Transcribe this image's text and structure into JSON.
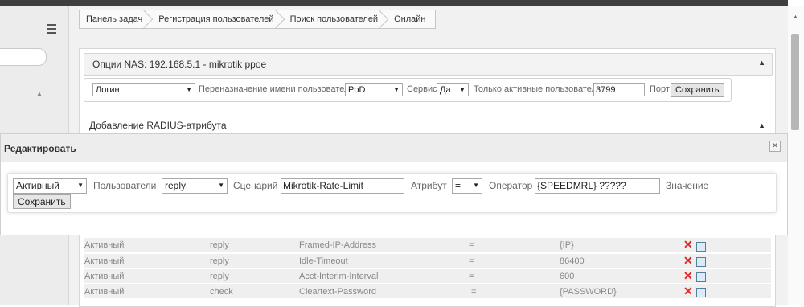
{
  "breadcrumb": [
    "Панель задач",
    "Регистрация пользователей",
    "Поиск пользователей",
    "Онлайн"
  ],
  "nas": {
    "title": "Опции NAS: 192.168.5.1 - mikrotik ppoe"
  },
  "filter": {
    "select_value": "Логин",
    "reassign_label": "Переназначение имени пользователя",
    "pod_value": "PoD",
    "service_label": "Сервис",
    "yes_value": "Да",
    "only_active_label": "Только активные пользователи",
    "active_input": "3799",
    "port_label": "Порт",
    "save_label": "Сохранить"
  },
  "radius": {
    "title": "Добавление RADIUS-атрибута"
  },
  "dialog": {
    "title": "Редактировать",
    "status_value": "Активный",
    "users_label": "Пользователи",
    "users_value": "reply",
    "scenario_label": "Сценарий",
    "scenario_value": "Mikrotik-Rate-Limit",
    "attribute_label": "Атрибут",
    "attribute_value": "=",
    "operator_label": "Оператор",
    "operator_value": "{SPEEDMRL} ?????",
    "value_label": "Значение",
    "save_label": "Сохранить"
  },
  "table": [
    {
      "status": "Активный",
      "type": "reply",
      "attr": "Framed-IP-Address",
      "op": "=",
      "value": "{IP}"
    },
    {
      "status": "Активный",
      "type": "reply",
      "attr": "Idle-Timeout",
      "op": "=",
      "value": "86400"
    },
    {
      "status": "Активный",
      "type": "reply",
      "attr": "Acct-Interim-Interval",
      "op": "=",
      "value": "600"
    },
    {
      "status": "Активный",
      "type": "check",
      "attr": "Cleartext-Password",
      "op": ":=",
      "value": "{PASSWORD}"
    }
  ],
  "icons": {
    "menu": "hamburger-icon",
    "up_arrow": "up-triangle",
    "close": "close-icon",
    "delete": "red-cross",
    "edit": "edit-icon"
  },
  "colors": {
    "delete": "#e22626",
    "title_text": "#333333"
  }
}
